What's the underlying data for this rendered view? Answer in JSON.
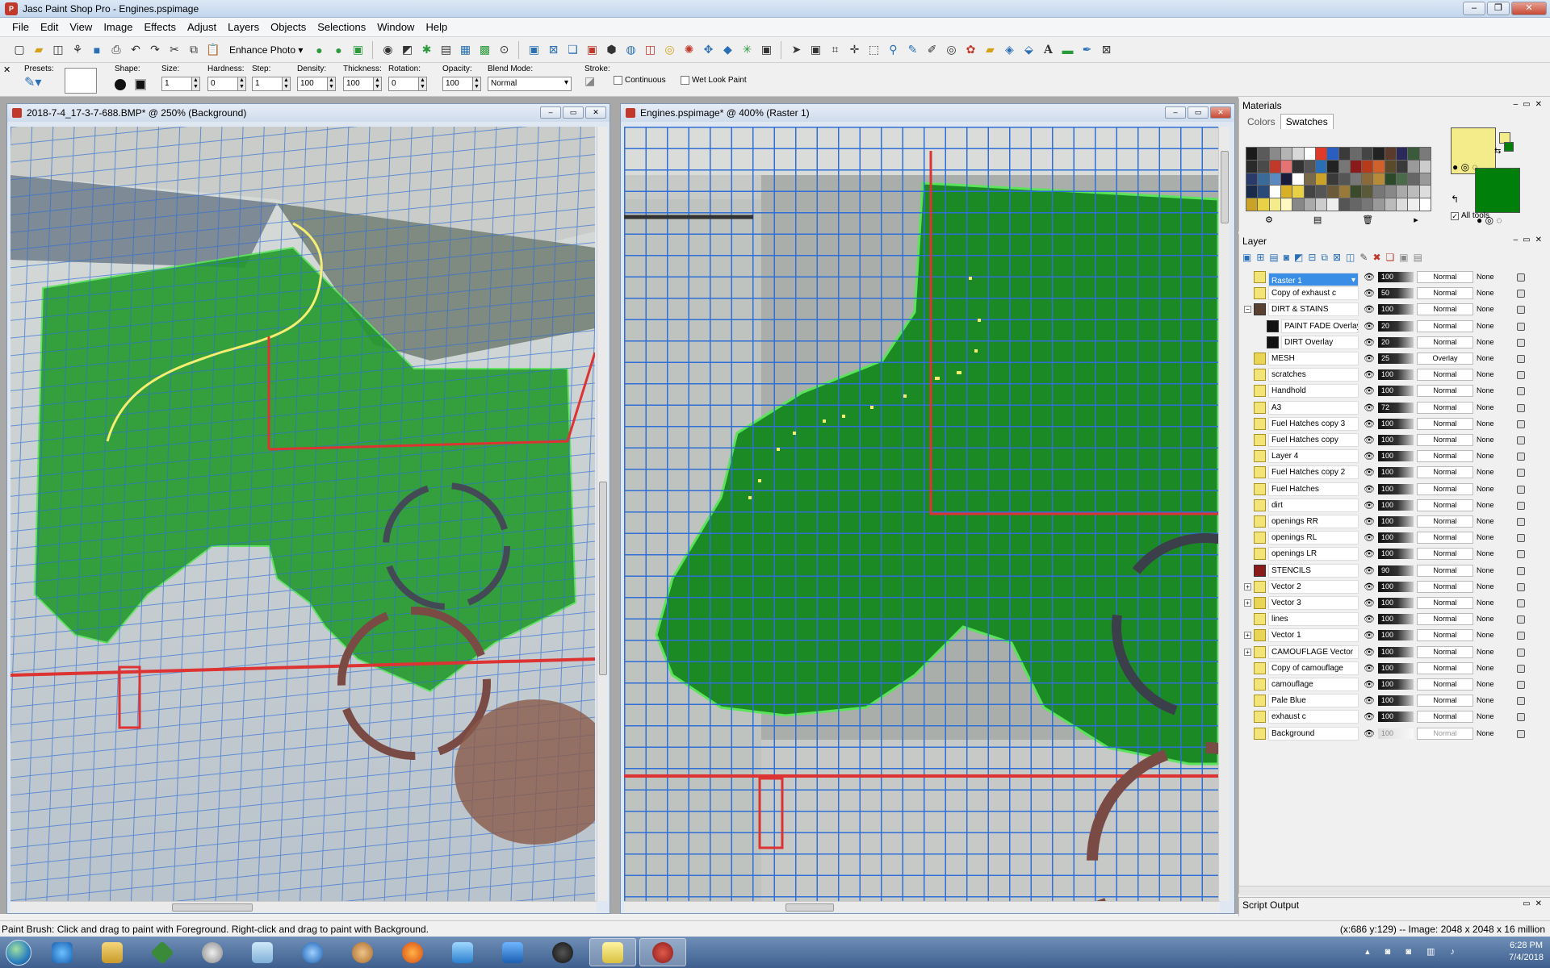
{
  "app": {
    "title": "Jasc Paint Shop Pro - Engines.pspimage"
  },
  "menu": [
    "File",
    "Edit",
    "View",
    "Image",
    "Effects",
    "Adjust",
    "Layers",
    "Objects",
    "Selections",
    "Window",
    "Help"
  ],
  "toolbar": {
    "enhance_label": "Enhance Photo"
  },
  "tooloptions": {
    "presets_label": "Presets:",
    "shape_label": "Shape:",
    "size_label": "Size:",
    "size_value": "1",
    "hardness_label": "Hardness:",
    "hardness_value": "0",
    "step_label": "Step:",
    "step_value": "1",
    "density_label": "Density:",
    "density_value": "100",
    "thickness_label": "Thickness:",
    "thickness_value": "100",
    "rotation_label": "Rotation:",
    "rotation_value": "0",
    "opacity_label": "Opacity:",
    "opacity_value": "100",
    "blend_label": "Blend Mode:",
    "blend_value": "Normal",
    "stroke_label": "Stroke:",
    "continuous_label": "Continuous",
    "wetlook_label": "Wet Look Paint"
  },
  "doc_left": {
    "title": "2018-7-4_17-3-7-688.BMP* @ 250% (Background)"
  },
  "doc_right": {
    "title": "Engines.pspimage* @ 400% (Raster 1)"
  },
  "materials": {
    "title": "Materials",
    "tab_colors": "Colors",
    "tab_swatches": "Swatches",
    "all_tools": "All tools",
    "fg_color": "#f4ec8a",
    "bg_color": "#00800a"
  },
  "swatches": [
    "#1a1a1a",
    "#5a5a5a",
    "#8a8a8a",
    "#b4b4b4",
    "#d8d8d8",
    "#ffffff",
    "#e03a2a",
    "#2a5fbf",
    "#3a3a3a",
    "#6a6a6a",
    "#444",
    "#222",
    "#5a3a2a",
    "#2a2a5a",
    "#3a5a3a",
    "#7a7a7a",
    "#2a2a2a",
    "#4a4a4a",
    "#c0392b",
    "#e57373",
    "#333",
    "#555",
    "#2a6fb6",
    "#222",
    "#777",
    "#8b1a1a",
    "#b73a1a",
    "#d1602a",
    "#5a4a2a",
    "#3a3a3a",
    "#9a9a9a",
    "#ccc",
    "#2a3a6a",
    "#3a6a9a",
    "#5a8abf",
    "#1a1a3a",
    "#ffffff",
    "#7a6a4a",
    "#c9a227",
    "#3a3a3a",
    "#555",
    "#777",
    "#8a6a3a",
    "#b78a3a",
    "#2a4a2a",
    "#4a6a4a",
    "#666",
    "#999",
    "#1a2a4a",
    "#2a4a7a",
    "#fff",
    "#d8b027",
    "#e8d047",
    "#444",
    "#555",
    "#6a5a3a",
    "#9a7a3a",
    "#3a4a2a",
    "#5a5a3a",
    "#777",
    "#888",
    "#aaa",
    "#bbb",
    "#ddd",
    "#c9a227",
    "#e8d047",
    "#f4ec8a",
    "#fff8c0",
    "#888",
    "#aaa",
    "#ccc",
    "#eee",
    "#555",
    "#666",
    "#777",
    "#999",
    "#bbb",
    "#ddd",
    "#eee",
    "#fff"
  ],
  "layer_panel": {
    "title": "Layer"
  },
  "layers": [
    {
      "name": "Raster 1",
      "opacity": "100",
      "blend": "Normal",
      "link": "None",
      "icon": "raster",
      "selected": true,
      "indent": 0
    },
    {
      "name": "Copy of exhaust c",
      "opacity": "50",
      "blend": "Normal",
      "link": "None",
      "icon": "raster",
      "indent": 0
    },
    {
      "name": "DIRT & STAINS",
      "opacity": "100",
      "blend": "Normal",
      "link": "None",
      "icon": "group",
      "indent": 0,
      "expand": "−"
    },
    {
      "name": "PAINT FADE Overlay",
      "opacity": "20",
      "blend": "Normal",
      "link": "None",
      "icon": "mask",
      "indent": 1
    },
    {
      "name": "DIRT Overlay",
      "opacity": "20",
      "blend": "Normal",
      "link": "None",
      "icon": "mask",
      "indent": 1
    },
    {
      "name": "MESH",
      "opacity": "25",
      "blend": "Overlay",
      "link": "None",
      "icon": "vec",
      "indent": 0
    },
    {
      "name": "scratches",
      "opacity": "100",
      "blend": "Normal",
      "link": "None",
      "icon": "raster",
      "indent": 0
    },
    {
      "name": "Handhold",
      "opacity": "100",
      "blend": "Normal",
      "link": "None",
      "icon": "raster",
      "indent": 0
    },
    {
      "name": "A3",
      "opacity": "72",
      "blend": "Normal",
      "link": "None",
      "icon": "raster",
      "indent": 0
    },
    {
      "name": "Fuel Hatches copy 3",
      "opacity": "100",
      "blend": "Normal",
      "link": "None",
      "icon": "raster",
      "indent": 0
    },
    {
      "name": "Fuel Hatches copy",
      "opacity": "100",
      "blend": "Normal",
      "link": "None",
      "icon": "raster",
      "indent": 0
    },
    {
      "name": "Layer 4",
      "opacity": "100",
      "blend": "Normal",
      "link": "None",
      "icon": "raster",
      "indent": 0
    },
    {
      "name": "Fuel Hatches copy 2",
      "opacity": "100",
      "blend": "Normal",
      "link": "None",
      "icon": "raster",
      "indent": 0
    },
    {
      "name": "Fuel Hatches",
      "opacity": "100",
      "blend": "Normal",
      "link": "None",
      "icon": "raster",
      "indent": 0
    },
    {
      "name": "dirt",
      "opacity": "100",
      "blend": "Normal",
      "link": "None",
      "icon": "raster",
      "indent": 0
    },
    {
      "name": "openings RR",
      "opacity": "100",
      "blend": "Normal",
      "link": "None",
      "icon": "raster",
      "indent": 0
    },
    {
      "name": "openings RL",
      "opacity": "100",
      "blend": "Normal",
      "link": "None",
      "icon": "raster",
      "indent": 0
    },
    {
      "name": "openings LR",
      "opacity": "100",
      "blend": "Normal",
      "link": "None",
      "icon": "raster",
      "indent": 0
    },
    {
      "name": "STENCILS",
      "opacity": "90",
      "blend": "Normal",
      "link": "None",
      "icon": "stencil",
      "indent": 0
    },
    {
      "name": "Vector 2",
      "opacity": "100",
      "blend": "Normal",
      "link": "None",
      "icon": "raster",
      "indent": 0,
      "expand": "+"
    },
    {
      "name": "Vector 3",
      "opacity": "100",
      "blend": "Normal",
      "link": "None",
      "icon": "vec",
      "indent": 0,
      "expand": "+"
    },
    {
      "name": "lines",
      "opacity": "100",
      "blend": "Normal",
      "link": "None",
      "icon": "raster",
      "indent": 0
    },
    {
      "name": "Vector 1",
      "opacity": "100",
      "blend": "Normal",
      "link": "None",
      "icon": "vec",
      "indent": 0,
      "expand": "+"
    },
    {
      "name": "CAMOUFLAGE Vector",
      "opacity": "100",
      "blend": "Normal",
      "link": "None",
      "icon": "raster",
      "indent": 0,
      "expand": "+"
    },
    {
      "name": "Copy of camouflage",
      "opacity": "100",
      "blend": "Normal",
      "link": "None",
      "icon": "raster",
      "indent": 0
    },
    {
      "name": "camouflage",
      "opacity": "100",
      "blend": "Normal",
      "link": "None",
      "icon": "raster",
      "indent": 0
    },
    {
      "name": "Pale Blue",
      "opacity": "100",
      "blend": "Normal",
      "link": "None",
      "icon": "raster",
      "indent": 0
    },
    {
      "name": "exhaust c",
      "opacity": "100",
      "blend": "Normal",
      "link": "None",
      "icon": "raster",
      "indent": 0
    },
    {
      "name": "Background",
      "opacity": "100",
      "blend": "Normal",
      "link": "None",
      "icon": "raster",
      "indent": 0,
      "dim": true
    }
  ],
  "script_output": {
    "title": "Script Output"
  },
  "status": {
    "hint": "Paint Brush: Click and drag to paint with Foreground. Right-click and drag to paint with Background.",
    "coords": "(x:686 y:129) -- Image:  2048 x 2048 x 16 million"
  },
  "taskbar": {
    "time": "6:28 PM",
    "date": "7/4/2018"
  }
}
